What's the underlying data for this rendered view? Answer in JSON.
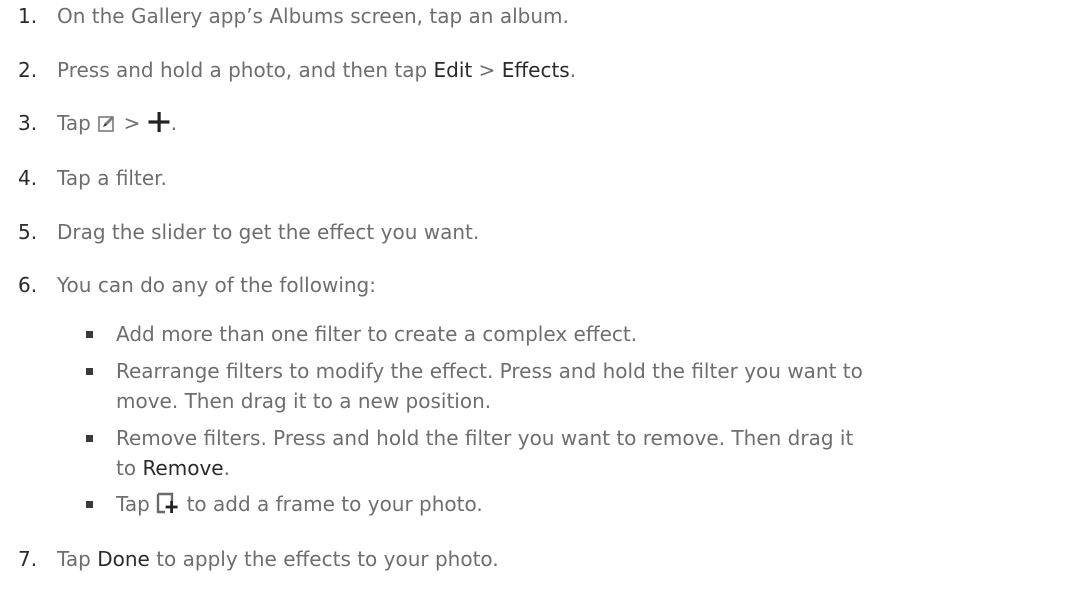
{
  "steps": [
    {
      "num": "1.",
      "text": "On the Gallery app’s Albums screen, tap an album."
    },
    {
      "num": "2.",
      "text_a": "Press and hold a photo, and then tap ",
      "em_1": "Edit",
      "text_b": " > ",
      "em_2": "Effects",
      "text_c": "."
    },
    {
      "num": "3.",
      "text_a": "Tap ",
      "icon_1": "edit-pencil-icon",
      "text_b": " > ",
      "icon_2": "plus-icon",
      "text_c": "."
    },
    {
      "num": "4.",
      "text": "Tap a filter."
    },
    {
      "num": "5.",
      "text": "Drag the slider to get the effect you want."
    },
    {
      "num": "6.",
      "text": "You can do any of the following:"
    },
    {
      "num": "7.",
      "text_a": "Tap ",
      "em_1": "Done",
      "text_b": " to apply the effects to your photo."
    }
  ],
  "bullets": [
    {
      "line1": "Add more than one filter to create a complex effect."
    },
    {
      "line1": "Rearrange filters to modify the effect. Press and hold the filter you want to",
      "line2": "move. Then drag it to a new position."
    },
    {
      "line1": "Remove filters. Press and hold the filter you want to remove. Then drag it",
      "line2_a": "to ",
      "line2_em": "Remove",
      "line2_b": "."
    },
    {
      "text_a": "Tap ",
      "icon": "add-frame-icon",
      "text_b": " to add a frame to your photo."
    }
  ],
  "colors": {
    "body_text": "#6e6e6e",
    "emphasis_text": "#2a2a2a",
    "icon_dark": "#222222",
    "icon_grey": "#7a7a7a"
  }
}
